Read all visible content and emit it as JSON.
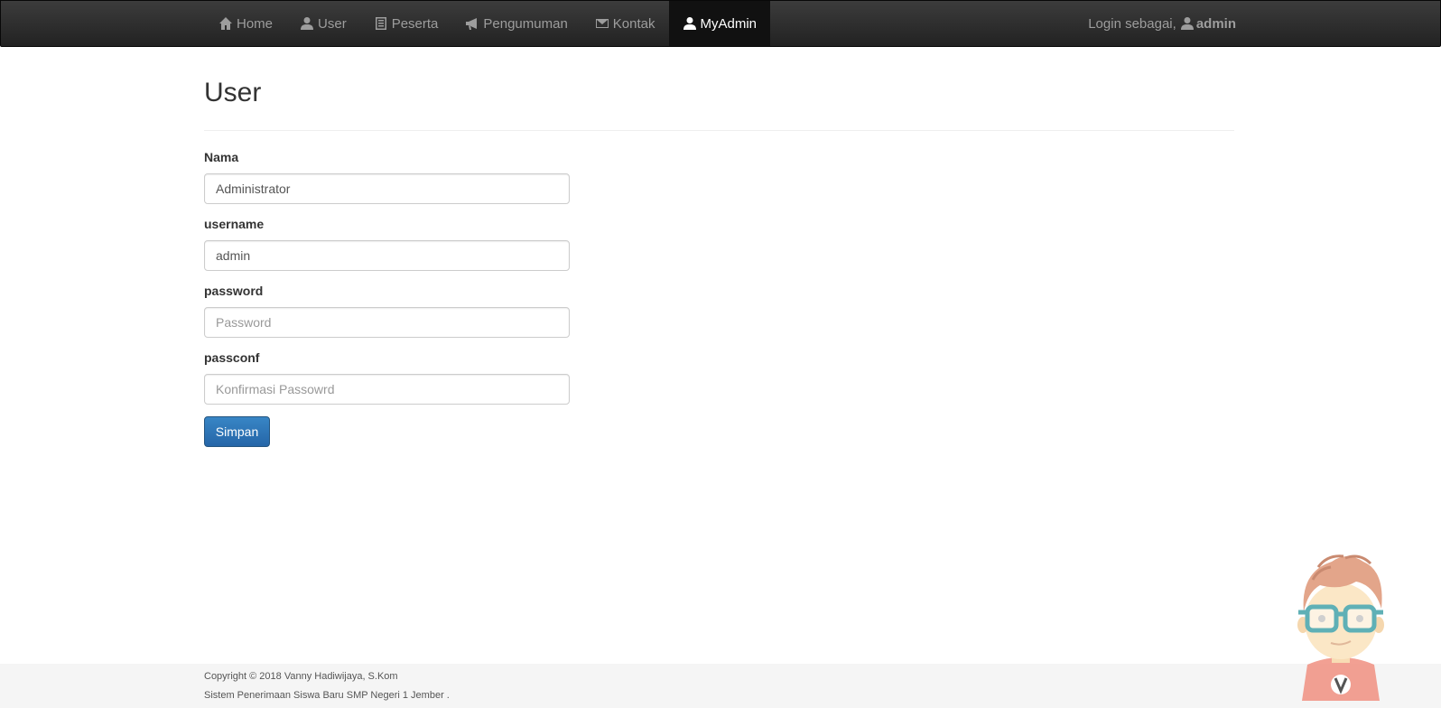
{
  "nav": {
    "items": [
      {
        "label": "Home",
        "icon": "home-icon"
      },
      {
        "label": "User",
        "icon": "user-icon"
      },
      {
        "label": "Peserta",
        "icon": "list-icon"
      },
      {
        "label": "Pengumuman",
        "icon": "bullhorn-icon"
      },
      {
        "label": "Kontak",
        "icon": "envelope-icon"
      },
      {
        "label": "MyAdmin",
        "icon": "user-icon",
        "active": true
      }
    ],
    "login_prefix": "Login sebagai,",
    "login_user": "admin"
  },
  "page": {
    "title": "User"
  },
  "form": {
    "nama": {
      "label": "Nama",
      "value": "Administrator"
    },
    "username": {
      "label": "username",
      "value": "admin"
    },
    "password": {
      "label": "password",
      "placeholder": "Password"
    },
    "passconf": {
      "label": "passconf",
      "placeholder": "Konfirmasi Passowrd"
    },
    "submit_label": "Simpan"
  },
  "footer": {
    "line1": "Copyright © 2018 Vanny Hadiwijaya, S.Kom",
    "line2": "Sistem Penerimaan Siswa Baru SMP Negeri 1 Jember ."
  },
  "colors": {
    "navbar": "#222222",
    "primary": "#337ab7",
    "footer_bg": "#f5f5f5"
  }
}
